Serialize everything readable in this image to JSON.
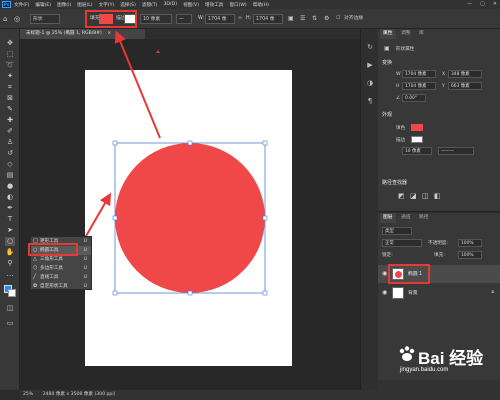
{
  "menubar": {
    "logo": "Ps",
    "items": [
      "文件(F)",
      "编辑(E)",
      "图像(I)",
      "图层(L)",
      "文字(Y)",
      "选择(S)",
      "滤镜(T)",
      "3D(D)",
      "视图(V)",
      "增效工具",
      "窗口(W)",
      "帮助(H)"
    ],
    "win_min": "—",
    "win_max": "▢",
    "win_close": "✕"
  },
  "optbar": {
    "mode": "形状",
    "fill_label": "填充:",
    "fill_color": "#f04848",
    "stroke_label": "描边:",
    "stroke_width": "10 像素",
    "w_label": "W:",
    "w_value": "1704 像",
    "h_label": "H:",
    "h_value": "1704 像",
    "align_edges": "对齐边缘"
  },
  "doc": {
    "tab_title": "未标题-1 @ 25% (椭圆 1, RGB/8#)",
    "tab_close": "×",
    "status_zoom": "25%",
    "status_info": "2480 像素 x 3508 像素 (300 ppi)"
  },
  "flyout": {
    "items": [
      {
        "label": "矩形工具",
        "key": "U"
      },
      {
        "label": "椭圆工具",
        "key": "U"
      },
      {
        "label": "三角形工具",
        "key": "U"
      },
      {
        "label": "多边形工具",
        "key": "U"
      },
      {
        "label": "直线工具",
        "key": "U"
      },
      {
        "label": "自定形状工具",
        "key": "U"
      }
    ]
  },
  "properties": {
    "tabs": [
      "属性",
      "调整",
      "库"
    ],
    "kind": "形状属性",
    "transform_head": "变换",
    "w_label": "W",
    "w_value": "1704 像素",
    "x_label": "X",
    "x_value": "348 像素",
    "h_label": "H",
    "h_value": "1704 像素",
    "y_label": "Y",
    "y_value": "663 像素",
    "angle_value": "0.00°",
    "appearance_head": "外观",
    "fill_label": "填色",
    "stroke_label": "描边",
    "stroke_width": "10 像素",
    "pathfinder_head": "路径查找器"
  },
  "layers": {
    "tabs": [
      "图层",
      "通道",
      "路径"
    ],
    "search": "类型",
    "blend": "正常",
    "opacity_label": "不透明度:",
    "opacity": "100%",
    "lock_label": "锁定:",
    "fill_label": "填充:",
    "fill": "100%",
    "rows": [
      {
        "name": "椭圆 1",
        "selected": true
      },
      {
        "name": "背景",
        "selected": false
      }
    ]
  },
  "watermark": {
    "brand": "Bai  经验",
    "url": "jingyan.baidu.com"
  },
  "colors": {
    "accent_red": "#e53935",
    "shape_fill": "#f04848",
    "selection": "#4a7fd6"
  }
}
